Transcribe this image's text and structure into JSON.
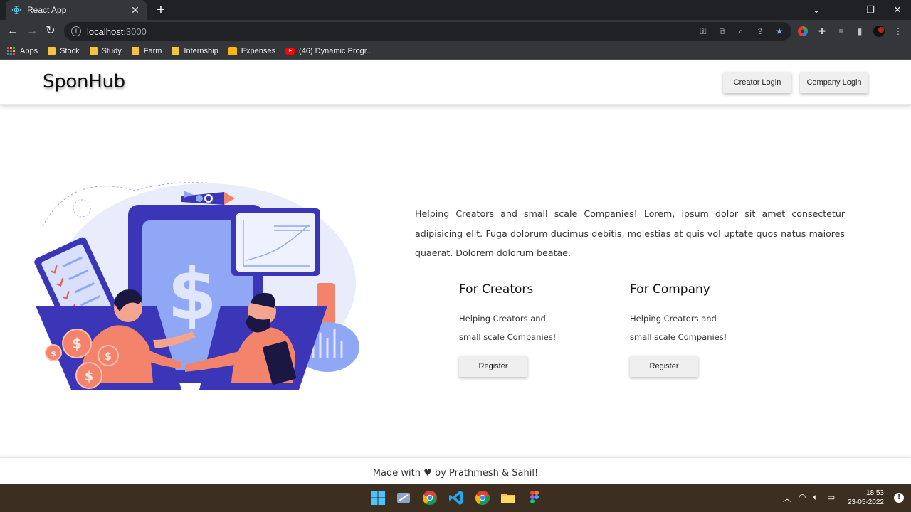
{
  "browser": {
    "tab_title": "React App",
    "tab_close": "✕",
    "new_tab": "+",
    "url_host": "localhost",
    "url_port": ":3000",
    "bookmarks": [
      "Apps",
      "Stock",
      "Study",
      "Farm",
      "Internship",
      "Expenses",
      "(46) Dynamic Progr..."
    ]
  },
  "navbar": {
    "brand": "SponHub",
    "creator_login": "Creator Login",
    "company_login": "Company Login"
  },
  "hero": {
    "description": "Helping Creators and small scale Companies! Lorem, ipsum dolor sit amet consectetur adipisicing elit. Fuga dolorum ducimus debitis, molestias at quis vol uptate quos natus maiores quaerat. Dolorem dolorum beatae.",
    "creators": {
      "heading": "For Creators",
      "line1": "Helping Creators and",
      "line2": "small scale Companies!",
      "button": "Register"
    },
    "company": {
      "heading": "For Company",
      "line1": "Helping Creators and",
      "line2": "small scale Companies!",
      "button": "Register"
    }
  },
  "footer": {
    "prefix": "Made with",
    "heart": "♥",
    "suffix": "by Prathmesh & Sahil!"
  },
  "taskbar": {
    "time": "18:53",
    "date": "23-05-2022"
  },
  "colors": {
    "page_bg": "#ffffff",
    "button_bg": "#efefef",
    "illus_purple": "#3b35b8",
    "illus_blue": "#8fa7f5",
    "illus_coral": "#f4836b"
  }
}
